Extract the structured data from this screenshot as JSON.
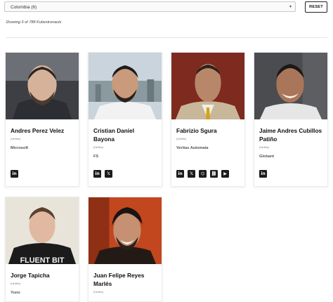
{
  "filter": {
    "country_select": "Colombia  (6)",
    "reset_label": "RESET"
  },
  "summary": "Showing 6 of 788 Kubestronauts",
  "cards": [
    {
      "name": "Andres Perez Velez",
      "pronouns": "(He/Him)",
      "company": "Microsoft",
      "icons": [
        "in"
      ]
    },
    {
      "name": "Cristian Daniel Bayona",
      "pronouns": "(He/Him)",
      "company": "FS",
      "icons": [
        "in",
        "𝕏"
      ]
    },
    {
      "name": "Fabrizio Sgura",
      "pronouns": "(He/Him)",
      "company": "Veritas Automata",
      "icons": [
        "in",
        "𝕏",
        "⌬",
        "⛓",
        "▶"
      ]
    },
    {
      "name": "Jaime Andres Cubillos Patiño",
      "pronouns": "(He/Him)",
      "company": "Globant",
      "icons": [
        "in"
      ]
    },
    {
      "name": "Jorge Tapicha",
      "pronouns": "(He/Him)",
      "company": "Yuno",
      "icons": []
    },
    {
      "name": "Juan Felipe Reyes Marlés",
      "pronouns": "(He/Him)",
      "company": "",
      "icons": []
    }
  ],
  "shirt_text": "FLUENT BIT",
  "colors": {
    "accent": "#222222",
    "card_border": "#ececec"
  }
}
